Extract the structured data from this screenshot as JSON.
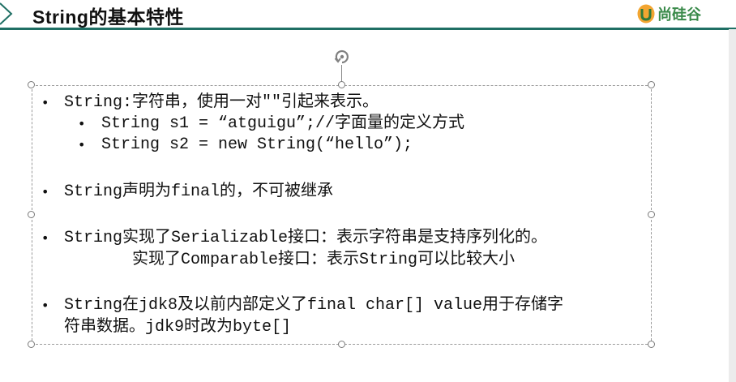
{
  "header": {
    "title": "String的基本特性",
    "logo_text": "尚硅谷",
    "logo_mark": "U",
    "accent_color": "#1f6f64",
    "logo_color": "#3a8a4a"
  },
  "canvas": {
    "rotate_icon": "rotate-handle-icon",
    "bullet_glyph": "•",
    "lines": [
      "String:字符串，使用一对\"\"引起来表示。",
      "String s1 = “atguigu”;//字面量的定义方式",
      "String s2 = new String(“hello”);",
      "String声明为final的，不可被继承",
      "String实现了Serializable接口：表示字符串是支持序列化的。",
      "实现了Comparable接口：表示String可以比较大小",
      "String在jdk8及以前内部定义了final char[] value用于存储字",
      "符串数据。jdk9时改为byte[]"
    ]
  }
}
